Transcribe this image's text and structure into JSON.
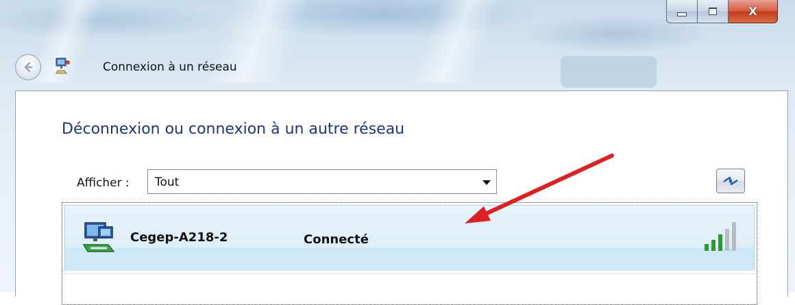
{
  "window": {
    "title": "Connexion à un réseau",
    "caption": {
      "close_label": "X"
    }
  },
  "main": {
    "heading": "Déconnexion ou connexion à un autre réseau",
    "filter": {
      "label": "Afficher :",
      "selected": "Tout"
    },
    "networks": [
      {
        "name": "Cegep-A218-2",
        "status": "Connecté",
        "signal_bars": 5
      }
    ]
  },
  "annotation": {
    "arrow_color": "#e02020"
  },
  "colors": {
    "heading": "#1e3287",
    "selected_row": "#d9edf9"
  },
  "icons": [
    "back-arrow-icon",
    "network-connect-icon",
    "refresh-icon",
    "wireless-network-icon",
    "signal-strength-icon"
  ]
}
